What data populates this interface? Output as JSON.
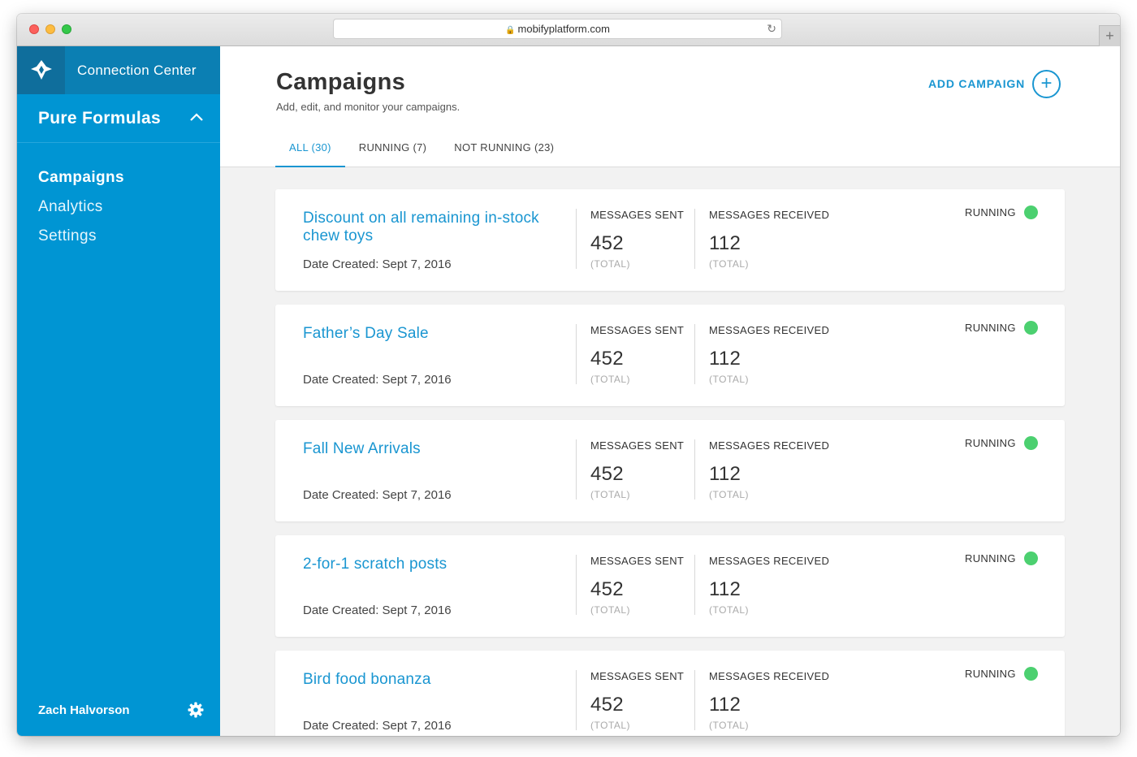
{
  "browser": {
    "url": "mobifyplatform.com"
  },
  "sidebar": {
    "brand": "Connection Center",
    "account": "Pure Formulas",
    "items": [
      {
        "label": "Campaigns",
        "active": true
      },
      {
        "label": "Analytics",
        "active": false
      },
      {
        "label": "Settings",
        "active": false
      }
    ],
    "user": "Zach Halvorson"
  },
  "header": {
    "title": "Campaigns",
    "subtitle": "Add, edit, and monitor your campaigns.",
    "add_label": "ADD CAMPAIGN",
    "add_symbol": "+"
  },
  "tabs": [
    {
      "label": "ALL (30)",
      "active": true
    },
    {
      "label": "RUNNING (7)",
      "active": false
    },
    {
      "label": "NOT RUNNING (23)",
      "active": false
    }
  ],
  "campaigns": [
    {
      "name": "Discount on all remaining in-stock chew toys",
      "date": "Date Created: Sept 7, 2016",
      "sent_label": "MESSAGES SENT",
      "sent": "452",
      "sent_sub": "(TOTAL)",
      "received_label": "MESSAGES RECEIVED",
      "received": "112",
      "received_sub": "(TOTAL)",
      "status": "RUNNING"
    },
    {
      "name": "Father’s Day Sale",
      "date": "Date Created: Sept 7, 2016",
      "sent_label": "MESSAGES SENT",
      "sent": "452",
      "sent_sub": "(TOTAL)",
      "received_label": "MESSAGES RECEIVED",
      "received": "112",
      "received_sub": "(TOTAL)",
      "status": "RUNNING"
    },
    {
      "name": "Fall New Arrivals",
      "date": "Date Created: Sept 7, 2016",
      "sent_label": "MESSAGES SENT",
      "sent": "452",
      "sent_sub": "(TOTAL)",
      "received_label": "MESSAGES RECEIVED",
      "received": "112",
      "received_sub": "(TOTAL)",
      "status": "RUNNING"
    },
    {
      "name": "2-for-1 scratch posts",
      "date": "Date Created: Sept 7, 2016",
      "sent_label": "MESSAGES SENT",
      "sent": "452",
      "sent_sub": "(TOTAL)",
      "received_label": "MESSAGES RECEIVED",
      "received": "112",
      "received_sub": "(TOTAL)",
      "status": "RUNNING"
    },
    {
      "name": "Bird food bonanza",
      "date": "Date Created: Sept 7, 2016",
      "sent_label": "MESSAGES SENT",
      "sent": "452",
      "sent_sub": "(TOTAL)",
      "received_label": "MESSAGES RECEIVED",
      "received": "112",
      "received_sub": "(TOTAL)",
      "status": "RUNNING"
    }
  ],
  "colors": {
    "sidebar": "#0095d3",
    "accent": "#1a96d1",
    "running": "#4cd070"
  },
  "icons": {
    "logo": "brand-logo-icon",
    "collapse": "chevron-up-icon",
    "settings": "gear-icon",
    "add": "plus-circle-icon",
    "status": "status-dot-icon"
  }
}
